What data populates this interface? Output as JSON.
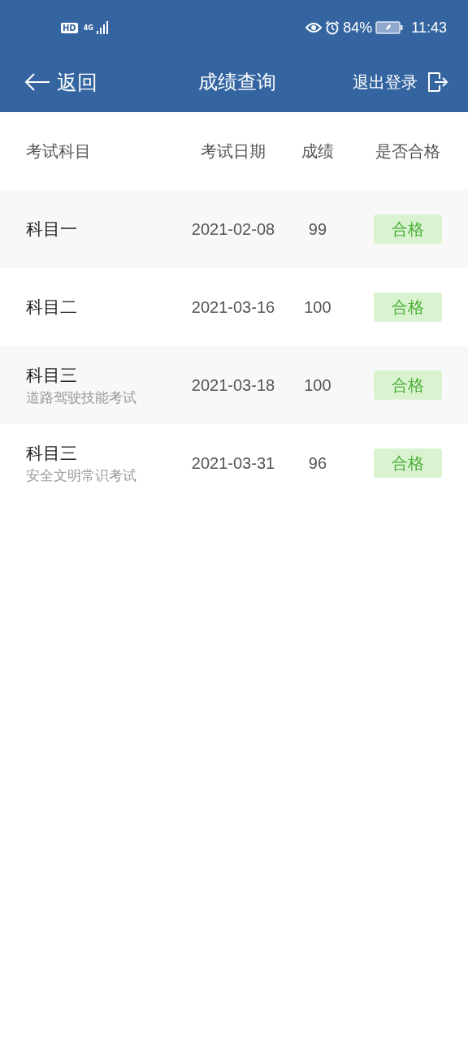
{
  "status_bar": {
    "hd": "HD",
    "network": "4G",
    "battery_percent": "84%",
    "time": "11:43"
  },
  "nav": {
    "back": "返回",
    "title": "成绩查询",
    "logout": "退出登录"
  },
  "table": {
    "columns": [
      "考试科目",
      "考试日期",
      "成绩",
      "是否合格"
    ],
    "rows": [
      {
        "subject": "科目一",
        "date": "2021-02-08",
        "score": "99",
        "result": "合格",
        "passed": true
      },
      {
        "subject": "科目二",
        "date": "2021-03-16",
        "score": "100",
        "result": "合格",
        "passed": true
      },
      {
        "subject": "科目三",
        "detail": "道路驾驶技能考试",
        "date": "2021-03-18",
        "score": "100",
        "result": "合格",
        "passed": true
      },
      {
        "subject": "科目三",
        "detail": "安全文明常识考试",
        "date": "2021-03-31",
        "score": "96",
        "result": "合格",
        "passed": true
      }
    ]
  }
}
